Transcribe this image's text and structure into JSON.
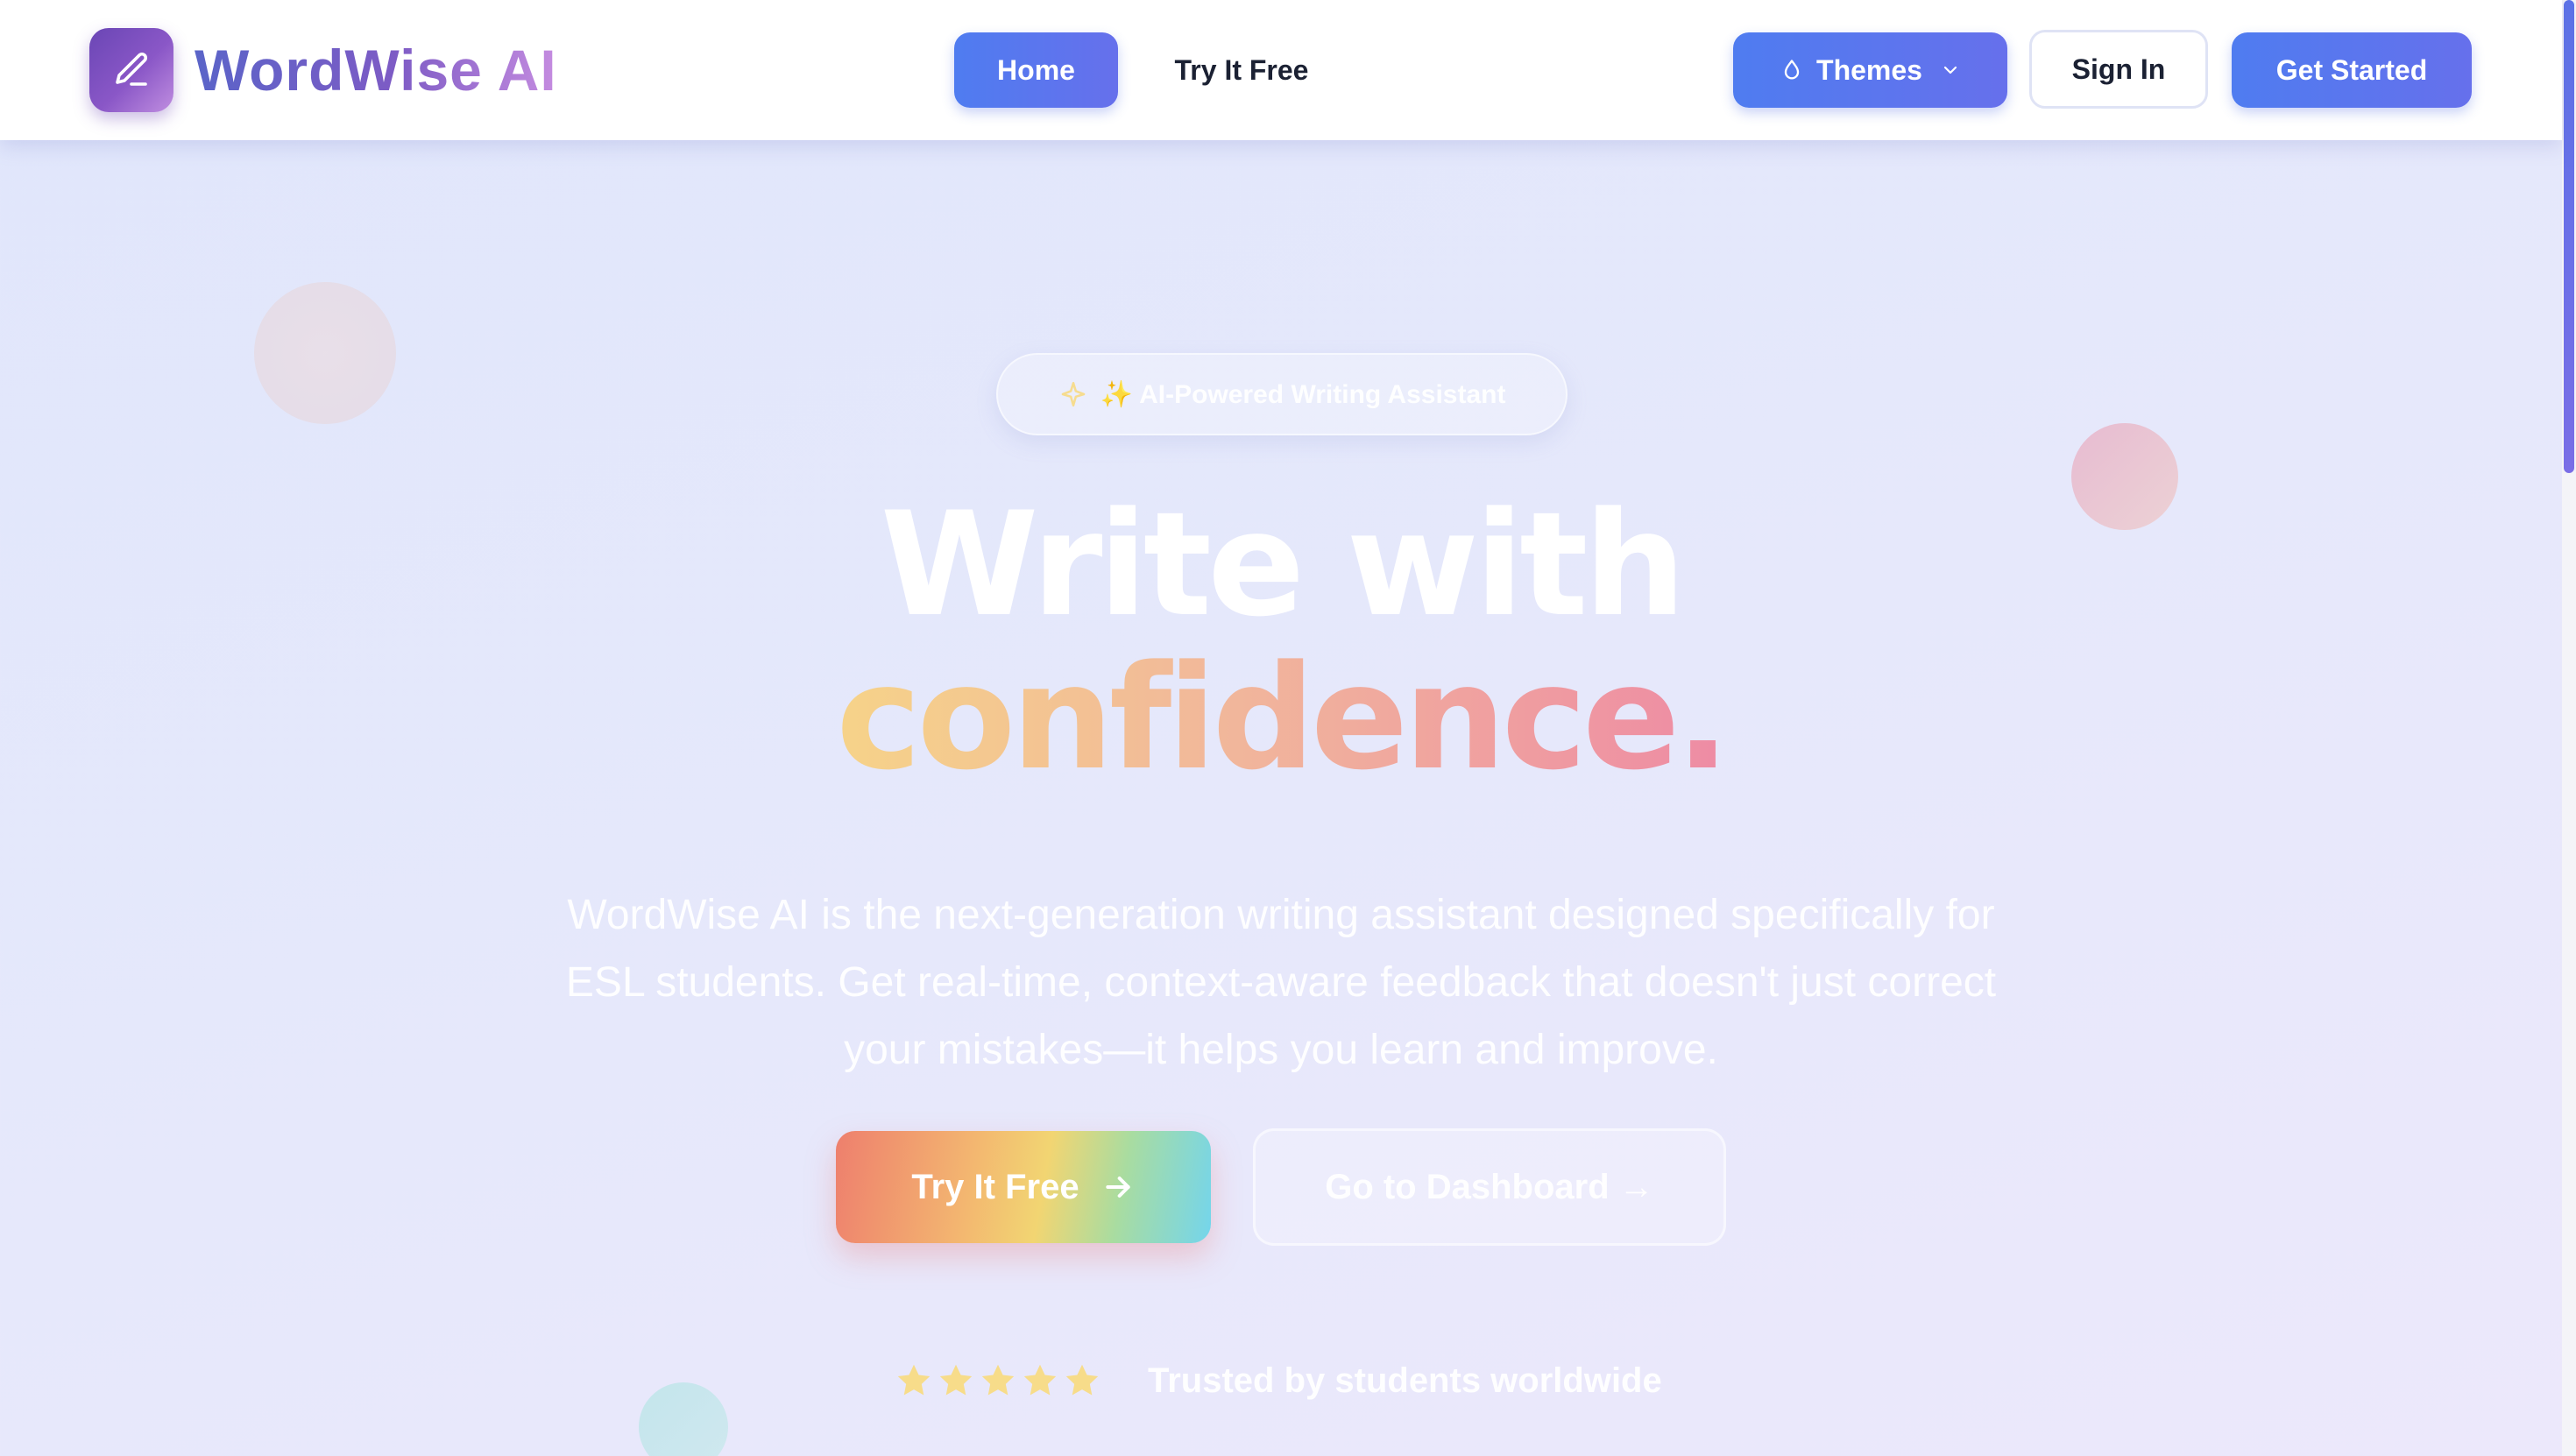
{
  "app": {
    "name": "WordWise AI"
  },
  "nav": {
    "links": [
      {
        "label": "Home",
        "active": true
      },
      {
        "label": "Try It Free",
        "active": false
      }
    ],
    "themes_label": "Themes",
    "sign_in_label": "Sign In",
    "get_started_label": "Get Started"
  },
  "hero": {
    "badge": "✨ AI-Powered Writing Assistant",
    "headline_line1": "Write with",
    "headline_line2": "confidence.",
    "description": "WordWise AI is the next-generation writing assistant designed specifically for ESL students. Get real-time, context-aware feedback that doesn't just correct your mistakes—it helps you learn and improve.",
    "cta_primary": "Try It Free",
    "cta_secondary": "Go to Dashboard →",
    "rating": 5,
    "trust_text": "Trusted by students worldwide"
  },
  "icons": {
    "logo": "pencil-icon",
    "themes": "droplet-icon",
    "themes_caret": "chevron-down-icon",
    "badge": "sparkle-icon",
    "cta_primary": "arrow-right-icon",
    "rating": "star-icon"
  },
  "colors": {
    "primary": "#4f7cf0",
    "logo_gradient_start": "#6a46b5",
    "logo_gradient_end": "#c08ee0",
    "star": "#f7dc8a",
    "text_dark": "#1b2133"
  }
}
